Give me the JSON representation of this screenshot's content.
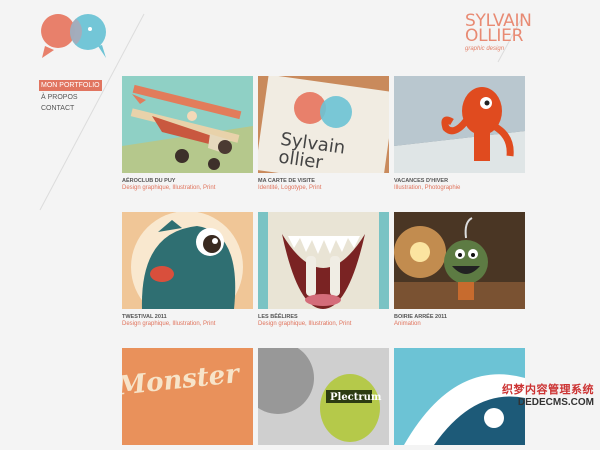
{
  "brand": {
    "name_line1": "SYLVAIN",
    "name_line2": "OLLIER",
    "tagline": "graphic design"
  },
  "nav": [
    {
      "label": "MON PORTFOLIO",
      "active": true
    },
    {
      "label": "À PROPOS",
      "active": false
    },
    {
      "label": "CONTACT",
      "active": false
    }
  ],
  "portfolio": [
    {
      "title": "AÉROCLUB DU PUY",
      "tags": "Design graphique, Illustration, Print"
    },
    {
      "title": "MA CARTE DE VISITE",
      "tags": "Identité, Logotype, Print"
    },
    {
      "title": "VACANCES D'HIVER",
      "tags": "Illustration, Photographie"
    },
    {
      "title": "TWESTIVAL 2011",
      "tags": "Design graphique, Illustration, Print"
    },
    {
      "title": "LES BÊÊLIRES",
      "tags": "Design graphique, Illustration, Print"
    },
    {
      "title": "BOIRIE ARRÉE 2011",
      "tags": "Animation"
    },
    {
      "title": "",
      "tags": ""
    },
    {
      "title": "",
      "tags": ""
    },
    {
      "title": "",
      "tags": ""
    }
  ],
  "thumb_text": {
    "card2_line1": "Sylvain",
    "card2_line2": "ollier",
    "card7_line1": "Monster",
    "card8_label": "Plectrum"
  },
  "watermark": {
    "cn": "织梦内容管理系统",
    "en": "DEDECMS.COM"
  },
  "colors": {
    "accent": "#e17560",
    "blue": "#6cc3d5",
    "salmon": "#e8806b"
  }
}
